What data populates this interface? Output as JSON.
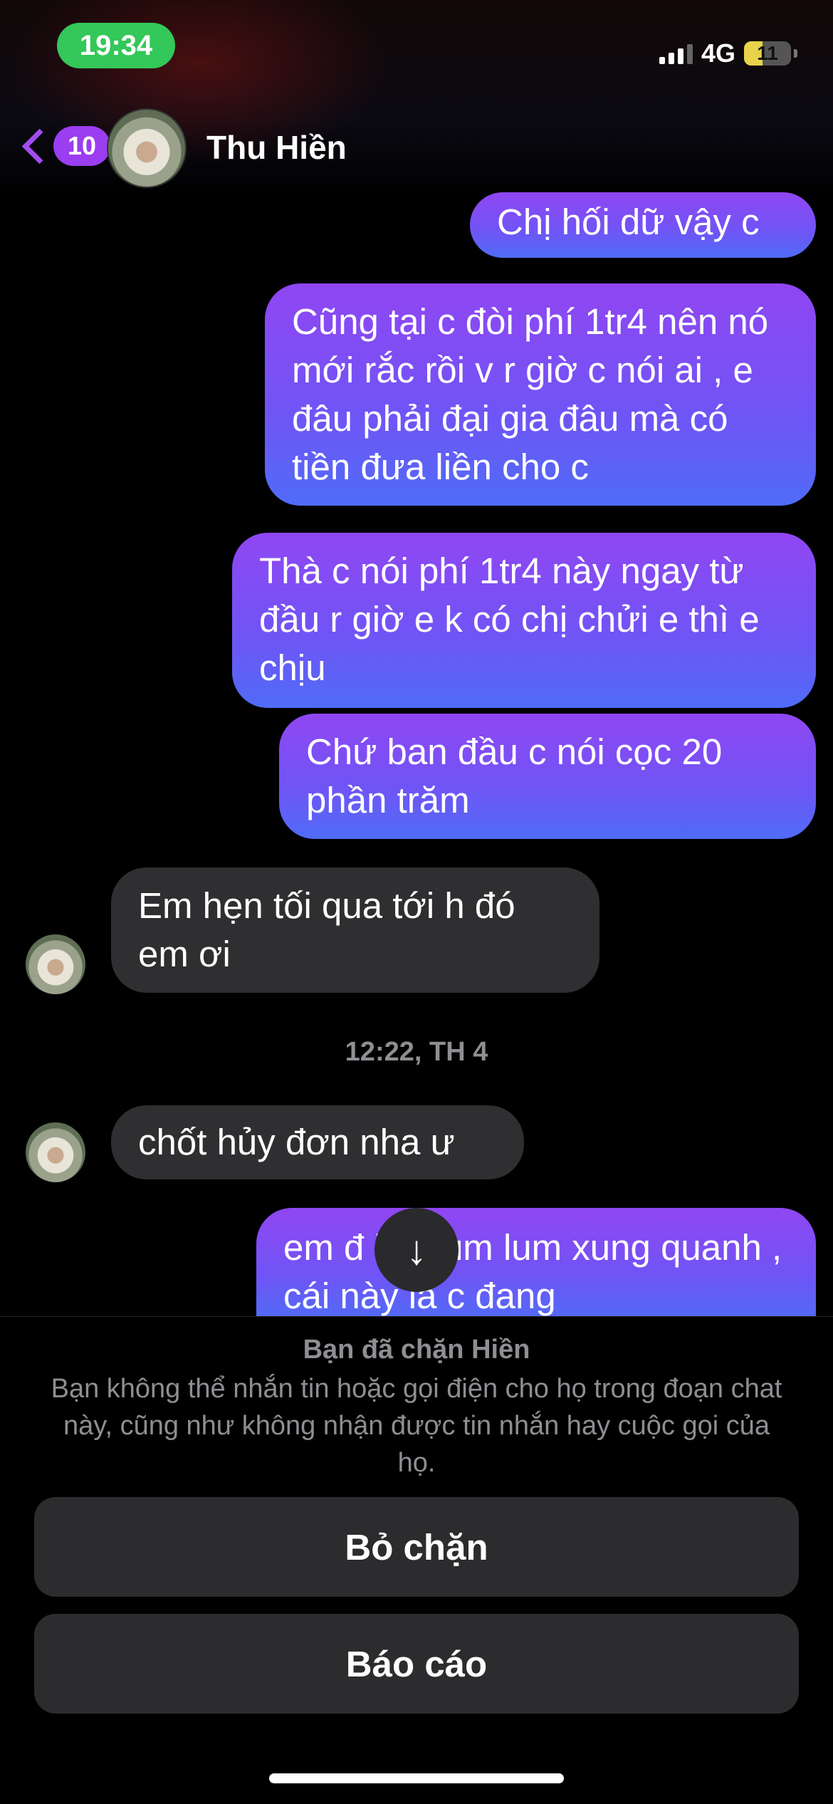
{
  "status_bar": {
    "time": "19:34",
    "network": "4G",
    "battery": "11",
    "battery_level_percent": 11,
    "colors": {
      "time_pill": "#34c759"
    }
  },
  "header": {
    "back_count": "10",
    "contact_name": "Thu Hiền",
    "accent_color": "#9b3df0"
  },
  "messages": [
    {
      "direction": "out",
      "text": "Chị hối dữ vậy c"
    },
    {
      "direction": "out",
      "text": "Cũng tại c đòi phí 1tr4 nên nó mới rắc rồi v r giờ c nói ai , e đâu phải đại gia đâu mà có tiền đưa liền cho c"
    },
    {
      "direction": "out",
      "text": "Thà c nói phí 1tr4 này ngay từ đầu r giờ e k có chị chửi e thì e chịu"
    },
    {
      "direction": "out",
      "text": "Chứ ban đầu c nói cọc 20 phần trăm"
    },
    {
      "direction": "in",
      "text": "Em hẹn tối qua tới h đó em ơi"
    },
    {
      "direction": "in",
      "text": "chốt hủy đơn nha ư"
    },
    {
      "direction": "out",
      "text": "em đ    hỏi tùm lum xung quanh , cái này là c đang"
    }
  ],
  "timestamp": "12:22, TH 4",
  "blocked_notice": {
    "title": "Bạn đã chặn Hiền",
    "description": "Bạn không thể nhắn tin hoặc gọi điện cho họ trong đoạn chat này, cũng như không nhận được tin nhắn hay cuộc gọi của họ.",
    "unblock_label": "Bỏ chặn",
    "report_label": "Báo cáo"
  },
  "icons": {
    "back": "chevron-left-icon",
    "scroll_down": "arrow-down-icon",
    "signal": "cellular-signal-icon",
    "battery": "battery-icon"
  }
}
